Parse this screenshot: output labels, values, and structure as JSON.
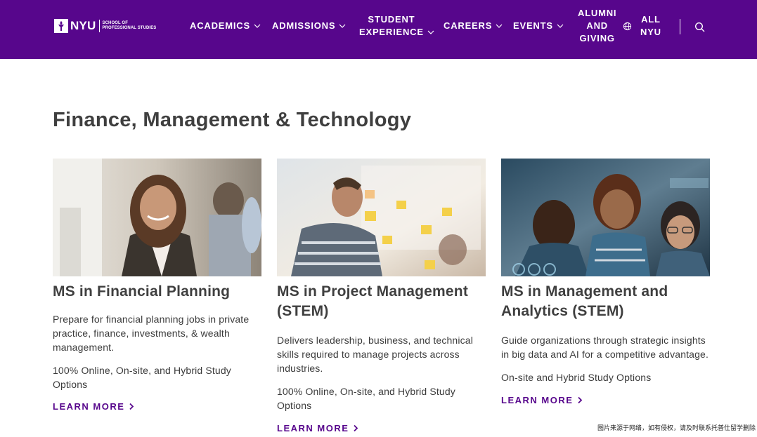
{
  "header": {
    "logo_text": "NYU",
    "logo_sub_line1": "SCHOOL OF",
    "logo_sub_line2": "PROFESSIONAL STUDIES",
    "nav": {
      "academics": "ACADEMICS",
      "admissions": "ADMISSIONS",
      "student_line1": "STUDENT",
      "student_line2": "EXPERIENCE",
      "careers": "CAREERS",
      "events": "EVENTS",
      "alumni_line1": "ALUMNI",
      "alumni_line2": "AND",
      "alumni_line3": "GIVING",
      "all_line1": "ALL",
      "all_line2": "NYU"
    }
  },
  "main": {
    "title": "Finance, Management & Technology",
    "cards": [
      {
        "title": "MS in Financial Planning",
        "description": "Prepare for financial planning jobs in private practice, finance, investments, & wealth management.",
        "options": "100% Online, On-site, and Hybrid Study Options",
        "link": "LEARN MORE"
      },
      {
        "title": "MS in Project Management (STEM)",
        "description": "Delivers leadership, business, and technical skills required to manage projects across industries.",
        "options": "100% Online, On-site, and Hybrid Study Options",
        "link": "LEARN MORE"
      },
      {
        "title": "MS in Management and Analytics (STEM)",
        "description": "Guide organizations through strategic insights in big data and AI for a competitive advantage.",
        "options": "On-site and Hybrid Study Options",
        "link": "LEARN MORE"
      }
    ]
  },
  "watermark": "图片来源于网络，如有侵权，请及时联系托普仕留学删除",
  "colors": {
    "brand_purple": "#57068c",
    "text": "#3b3b3b"
  }
}
